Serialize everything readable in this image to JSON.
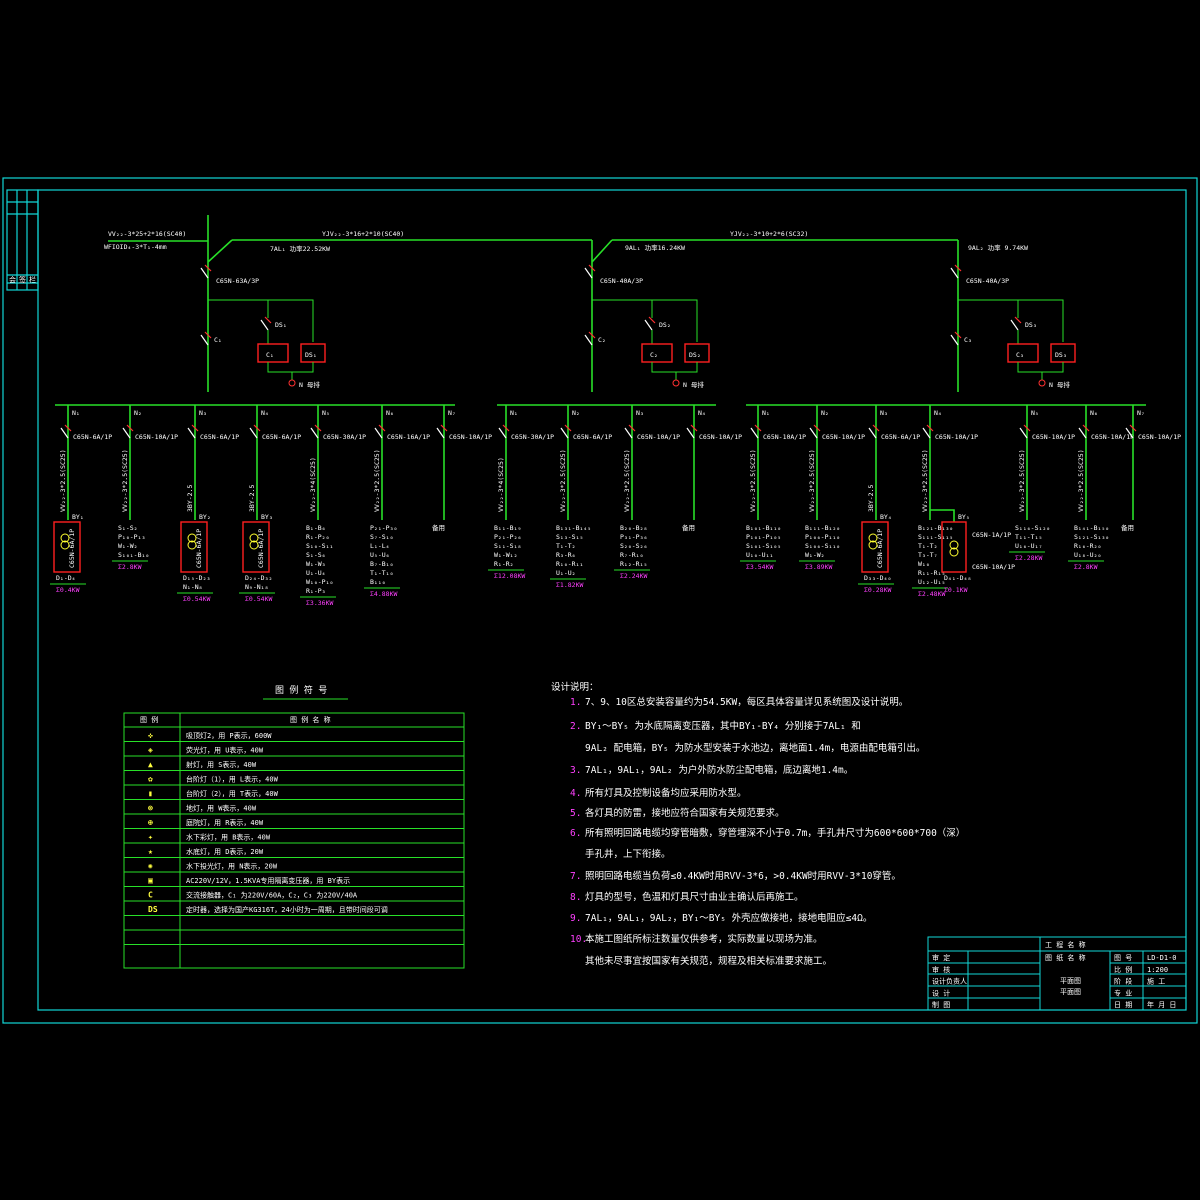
{
  "incoming": {
    "cable_main": "VV₂₂-3*25+2*16(SC40)",
    "cable_sub": "WFIOID₄-3*T₁-4mm",
    "feeder1_cable": "YJV₂₂-3*16+2*10(SC40)",
    "feeder2_cable": "YJV₂₂-3*10+2*6(SC32)",
    "feeder1_label": "7AL₁ 功率22.52KW",
    "feeder2_label": "9AL₁ 功率16.24KW",
    "feeder3_label": "9AL₂ 功率 9.74KW"
  },
  "panels": [
    {
      "breaker": "C65N-63A/3P",
      "contactor": "C₁",
      "c_box": "C₁",
      "ds_box": "DS₁",
      "ds_sw": "DS₁",
      "neutral": "N 母排"
    },
    {
      "breaker": "C65N-40A/3P",
      "contactor": "C₂",
      "c_box": "C₂",
      "ds_box": "DS₂",
      "ds_sw": "DS₂",
      "neutral": "N 母排"
    },
    {
      "breaker": "C65N-40A/3P",
      "contactor": "C₃",
      "c_box": "C₃",
      "ds_box": "DS₃",
      "ds_sw": "DS₃",
      "neutral": "N 母排"
    }
  ],
  "branches": [
    {
      "n": "N₁",
      "brk": "C65N-6A/1P",
      "cable": "VV₂₂-3*2.5(SC25)",
      "loads": [
        "BY₁",
        "D₁-D₄"
      ],
      "kw": "0.4KW",
      "box": true
    },
    {
      "n": "N₂",
      "brk": "C65N-10A/1P",
      "cable": "VV₂₂-3*2.5(SC25)",
      "loads": [
        "S₁-S₂",
        "P₁₀-P₁₃",
        "W₁-W₂",
        "S₁₀₁-B₁₀"
      ],
      "kw": "2.8KW",
      "box": false
    },
    {
      "n": "N₃",
      "brk": "C65N-6A/1P",
      "cable": "3BY-2.5",
      "loads": [
        "BY₂",
        "D₁₅-D₂₃",
        "N₁-N₈"
      ],
      "kw": "0.54KW",
      "box": true
    },
    {
      "n": "N₄",
      "brk": "C65N-6A/1P",
      "cable": "3BY-2.5",
      "loads": [
        "BY₃",
        "D₂₄-D₃₂",
        "N₉-N₁₈"
      ],
      "kw": "0.54KW",
      "box": true
    },
    {
      "n": "N₅",
      "brk": "C65N-30A/1P",
      "cable": "VV₂₂-3*4(SC25)",
      "loads": [
        "B₁-B₆",
        "R₁-P₂₀",
        "S₁₀-S₁₁",
        "S₁-S₆",
        "W₁-W₃",
        "U₁-U₄",
        "W₁₀-P₁₀",
        "R₁-P₃"
      ],
      "kw": "3.36KW",
      "box": false
    },
    {
      "n": "N₆",
      "brk": "C65N-16A/1P",
      "cable": "VV₂₂-3*2.5(SC25)",
      "loads": [
        "P₂₁-P₃₀",
        "S₇-S₁₀",
        "L₁-L₄",
        "U₅-U₆",
        "B₇-B₁₀",
        "T₁-T₁₀",
        "B₁₁₀"
      ],
      "kw": "4.88KW",
      "box": false
    },
    {
      "n": "N₇",
      "brk": "C65N-10A/1P",
      "cable": "",
      "loads": [
        "备用"
      ],
      "kw": "",
      "box": false
    },
    {
      "n": "N₁",
      "brk": "C65N-30A/1P",
      "cable": "VV₂₂-3*4(SC25)",
      "loads": [
        "B₁₁-B₁₉",
        "P₂₁-P₂₆",
        "S₁₁-S₁₈",
        "W₁-W₁₂",
        "R₁-R₂"
      ],
      "kw": "12.08KW",
      "box": false
    },
    {
      "n": "N₂",
      "brk": "C65N-6A/1P",
      "cable": "VV₂₂-3*2.5(SC25)",
      "loads": [
        "B₁₃₁-B₁₄₅",
        "S₁₃-S₁₅",
        "T₁-T₂",
        "R₃-R₆",
        "R₁₀-R₁₁",
        "U₁-U₂"
      ],
      "kw": "1.82KW",
      "box": false
    },
    {
      "n": "N₃",
      "brk": "C65N-10A/1P",
      "cable": "VV₂₂-3*2.5(SC25)",
      "loads": [
        "B₂₀-B₂₈",
        "P₃₁-P₃₆",
        "S₂₀-S₂₆",
        "R₇-R₁₀",
        "R₁₂-R₁₅"
      ],
      "kw": "2.24KW",
      "box": false
    },
    {
      "n": "N₄",
      "brk": "C65N-10A/1P",
      "cable": "",
      "loads": [
        "备用"
      ],
      "kw": "",
      "box": false
    },
    {
      "n": "N₁",
      "brk": "C65N-10A/1P",
      "cable": "VV₂₂-3*2.5(SC25)",
      "loads": [
        "B₁₀₁-B₁₁₀",
        "P₁₀₁-P₁₀₅",
        "S₁₀₁-S₁₀₅",
        "U₁₀-U₁₁"
      ],
      "kw": "3.54KW",
      "box": false
    },
    {
      "n": "N₂",
      "brk": "C65N-10A/1P",
      "cable": "VV₂₂-3*2.5(SC25)",
      "loads": [
        "B₁₁₁-B₁₂₀",
        "P₁₀₆-P₁₁₀",
        "S₁₀₆-S₁₁₀",
        "W₁-W₂"
      ],
      "kw": "3.89KW",
      "box": false
    },
    {
      "n": "N₃",
      "brk": "C65N-6A/1P",
      "cable": "3BY-2.5",
      "loads": [
        "BY₄",
        "D₃₃-D₄₀"
      ],
      "kw": "0.28KW",
      "box": true
    },
    {
      "n": "N₄",
      "brk": "C65N-10A/1P",
      "cable": "VV₂₂-3*2.5(SC25)",
      "loads": [
        "B₁₂₁-B₁₃₀",
        "S₁₁₁-S₁₁₅",
        "T₁-T₂",
        "T₃-T₇",
        "W₁₀",
        "R₁₁-R₁₅",
        "U₁₂-U₁₅"
      ],
      "kw": "2.48KW",
      "box": false
    },
    {
      "n": "N₅",
      "brk": "C65N-10A/1P",
      "cable": "VV₂₂-3*2.5(SC25)",
      "loads": [
        "S₁₁₆-S₁₂₀",
        "T₁₁-T₁₅",
        "U₁₆-U₁₇"
      ],
      "kw": "2.28KW",
      "box": false
    },
    {
      "n": "N₆",
      "brk": "C65N-10A/1P",
      "cable": "VV₂₂-3*2.5(SC25)",
      "loads": [
        "B₁₄₁-B₁₅₀",
        "S₁₂₁-S₁₃₀",
        "R₁₆-R₂₀",
        "U₁₈-U₂₀"
      ],
      "kw": "2.8KW",
      "box": false
    },
    {
      "n": "N₇",
      "brk": "C65N-10A/1P",
      "cable": "",
      "loads": [
        "备用"
      ],
      "kw": "",
      "box": false
    }
  ],
  "by5": {
    "label": "BY₅",
    "brk1": "C65N-1A/1P",
    "brk2": "C65N-10A/1P",
    "load": "D₄₁-D₄₈",
    "kw": "0.1KW"
  },
  "legend": {
    "title": "图 例 符 号",
    "header_symbol": "图 例",
    "header_name": "图 例 名 称",
    "rows": [
      {
        "sym": "✜",
        "text": "吸顶灯2，用 P表示，600W"
      },
      {
        "sym": "◈",
        "text": "荧光灯，用 U表示，40W"
      },
      {
        "sym": "▲",
        "text": "射灯，用 S表示，40W"
      },
      {
        "sym": "✿",
        "text": "台阶灯（1），用 L表示，40W"
      },
      {
        "sym": "▮",
        "text": "台阶灯（2），用 T表示，40W"
      },
      {
        "sym": "⊗",
        "text": "地灯，用 W表示，40W"
      },
      {
        "sym": "⊕",
        "text": "庭院灯，用 R表示，40W"
      },
      {
        "sym": "✦",
        "text": "水下彩灯，用 B表示，40W"
      },
      {
        "sym": "★",
        "text": "水底灯，用 D表示，20W"
      },
      {
        "sym": "✺",
        "text": "水下投光灯，用 N表示，20W"
      },
      {
        "sym": "▣",
        "text": "AC220V/12V，1.5KVA专用隔离变压器，用 BY表示"
      },
      {
        "sym": "C",
        "text": "交流接触器，C₁ 为220V/60A，C₂，C₃ 为220V/40A"
      },
      {
        "sym": "DS",
        "text": "定时器，选择为国产KG316T，24小时为一周期，且带时间段可调"
      },
      {
        "sym": "",
        "text": ""
      },
      {
        "sym": "",
        "text": ""
      },
      {
        "sym": "",
        "text": ""
      }
    ]
  },
  "notes": {
    "title": "设计说明：",
    "items": [
      {
        "num": "1.",
        "text": "7、9、10区总安装容量约为54.5KW，每区具体容量详见系统图及设计说明。"
      },
      {
        "num": "2.",
        "text": "BY₁～BY₅ 为水底隔离变压器，其中BY₁-BY₄ 分别接于7AL₁ 和"
      },
      {
        "num": "",
        "text": "9AL₂ 配电箱，BY₅ 为防水型安装于水池边，离地面1.4m，电源由配电箱引出。"
      },
      {
        "num": "3.",
        "text": "7AL₁，9AL₁，9AL₂ 为户外防水防尘配电箱，底边离地1.4m。"
      },
      {
        "num": "4.",
        "text": "所有灯具及控制设备均应采用防水型。"
      },
      {
        "num": "5.",
        "text": "各灯具的防雷，接地应符合国家有关规范要求。"
      },
      {
        "num": "6.",
        "text": "所有照明回路电缆均穿管暗敷，穿管埋深不小于0.7m，手孔井尺寸为600*600*700（深）"
      },
      {
        "num": "",
        "text": "手孔井，上下衔接。"
      },
      {
        "num": "7.",
        "text": "照明回路电缆当负荷≤0.4KW时用RVV-3*6，>0.4KW时用RVV-3*10穿管。"
      },
      {
        "num": "8.",
        "text": "灯具的型号，色温和灯具尺寸由业主确认后再施工。"
      },
      {
        "num": "9.",
        "text": "7AL₁，9AL₁，9AL₂，BY₁～BY₅ 外壳应做接地，接地电阻应≤4Ω。"
      },
      {
        "num": "10.",
        "text": "本施工图纸所标注数量仅供参考，实际数量以现场为准。"
      },
      {
        "num": "",
        "text": "其他未尽事宜按国家有关规范，规程及相关标准要求施工。"
      }
    ]
  },
  "title_block": {
    "project_label": "工 程 名 称",
    "drawing_label": "图 纸 名 称",
    "drawing_name_1": "平面图",
    "drawing_name_2": "平面图",
    "roles": [
      "审 定",
      "审 核",
      "设计负责人",
      "设 计",
      "制 图"
    ],
    "fields": [
      {
        "k": "图 号",
        "v": "LD-D1-0"
      },
      {
        "k": "比 例",
        "v": "1:200"
      },
      {
        "k": "阶 段",
        "v": "施 工"
      },
      {
        "k": "专 业",
        "v": ""
      },
      {
        "k": "日 期",
        "v": "年 月 日"
      }
    ]
  },
  "side_stamp": [
    "会",
    "签",
    "栏"
  ]
}
